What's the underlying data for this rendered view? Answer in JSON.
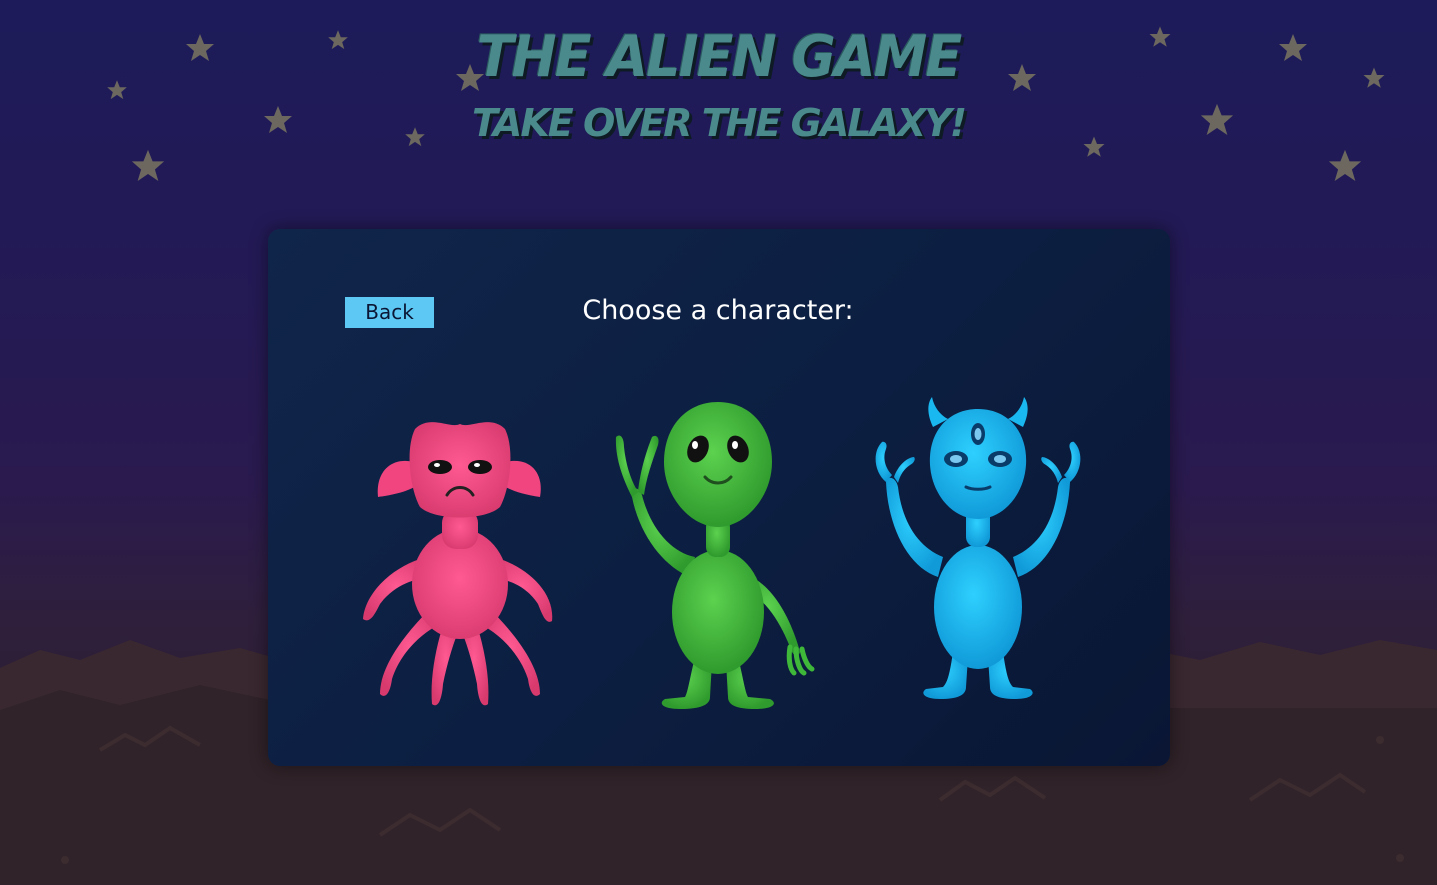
{
  "header": {
    "title": "THE ALIEN GAME",
    "subtitle": "TAKE OVER THE GALAXY!"
  },
  "panel": {
    "back_label": "Back",
    "prompt": "Choose a character:"
  },
  "characters": [
    {
      "id": "pink-alien",
      "color": "#f0457f"
    },
    {
      "id": "green-alien",
      "color": "#3fb83a"
    },
    {
      "id": "blue-alien",
      "color": "#1ab8f0"
    }
  ],
  "colors": {
    "title": "#4a8a8c",
    "button": "#5ec8f4",
    "panel": "#0c1f42",
    "star": "#6b6a58"
  }
}
